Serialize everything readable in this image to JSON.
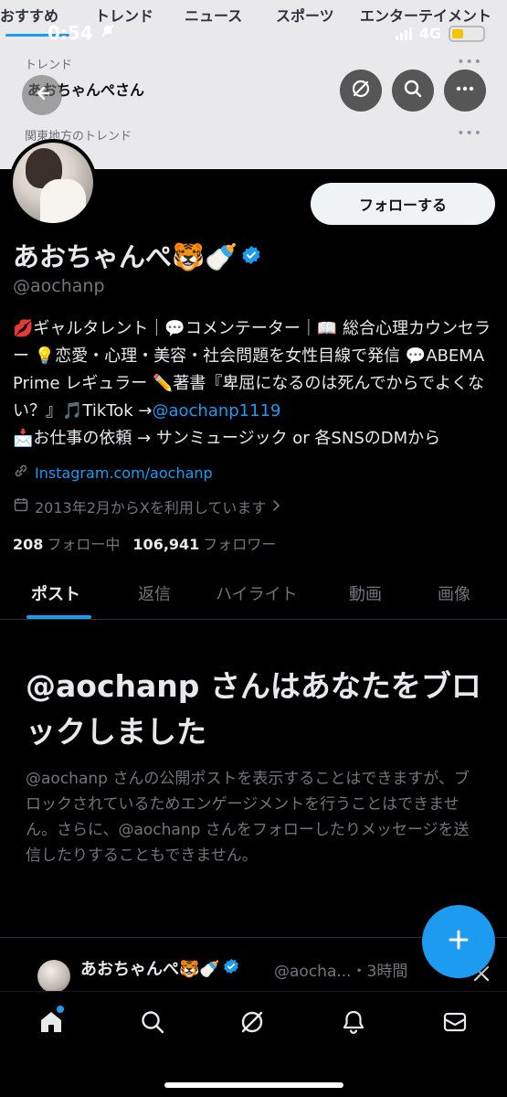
{
  "top_tabs": [
    "おすすめ",
    "トレンド",
    "ニュース",
    "スポーツ",
    "エンターテイメント"
  ],
  "status": {
    "time": "0:54",
    "network": "4G"
  },
  "banner": {
    "trend_label": "トレンド",
    "trend_name": "あおちゃんぺさん",
    "region_label": "関東地方のトレンド",
    "dots": "•••"
  },
  "profile": {
    "follow_label": "フォローする",
    "display_name": "あおちゃんぺ🐯🍼",
    "handle": "@aochanp",
    "bio_text": "💋ギャルタレント｜💬コメンテーター｜📖 総合心理カウンセラー 💡恋愛・心理・美容・社会問題を女性目線で発信 💬ABEMA Prime レギュラー ✏️著書『卑屈になるのは死んでからでよくない？』🎵TikTok →",
    "bio_link": "@aochanp1119",
    "bio_text2": "📩お仕事の依頼 → サンミュージック or 各SNSのDMから",
    "website": "Instagram.com/aochanp",
    "joined": "2013年2月からXを利用しています",
    "following_count": "208",
    "following_label": "フォロー中",
    "followers_count": "106,941",
    "followers_label": "フォロワー"
  },
  "tabs": [
    "ポスト",
    "返信",
    "ハイライト",
    "動画",
    "画像"
  ],
  "blocked": {
    "title": "@aochanp さんはあなたをブロックしました",
    "description": "@aochanp さんの公開ポストを表示することはできますが、ブロックされているためエンゲージメントを行うことはできません。さらに、@aochanp さんをフォローしたりメッセージを送信したりすることもできません。"
  },
  "post_preview": {
    "name": "あおちゃんぺ🐯🍼",
    "meta": "@aocha...・3時間"
  },
  "colors": {
    "accent": "#1d9bf0",
    "background": "#000000",
    "muted": "#71767b"
  },
  "icons": [
    "back-arrow-icon",
    "grok-icon",
    "search-icon",
    "more-icon",
    "verified-icon",
    "link-icon",
    "calendar-icon",
    "plus-icon",
    "home-icon",
    "notifications-icon",
    "mail-icon"
  ]
}
